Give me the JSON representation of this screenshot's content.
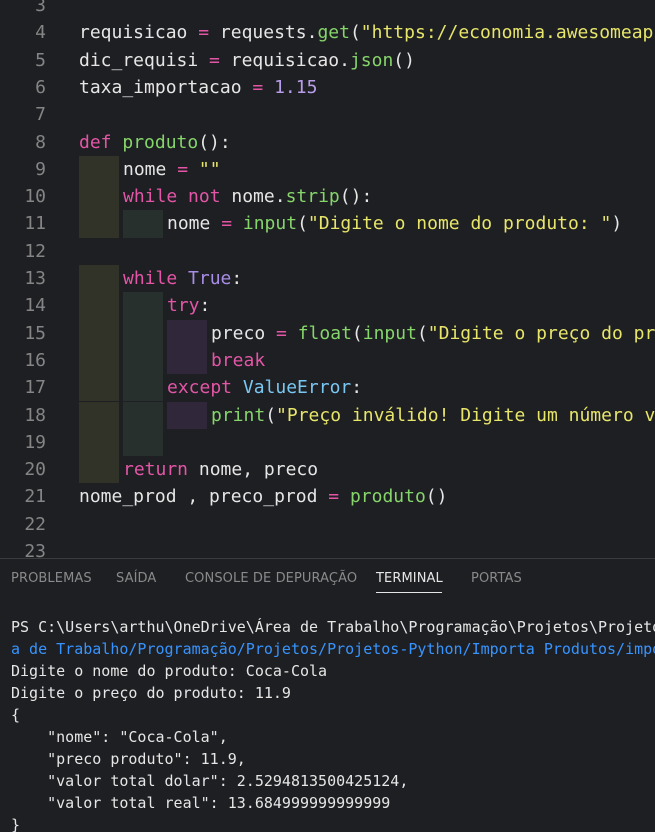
{
  "editor": {
    "lines": [
      {
        "num": "3",
        "tokens": []
      },
      {
        "num": "4",
        "tokens": [
          [
            "",
            "requisicao "
          ],
          [
            "op",
            "="
          ],
          [
            "",
            " requests."
          ],
          [
            "fn",
            "get"
          ],
          [
            "",
            "("
          ],
          [
            "str",
            "\"https://economia.awesomeapi"
          ]
        ]
      },
      {
        "num": "5",
        "tokens": [
          [
            "",
            "dic_requisi "
          ],
          [
            "op",
            "="
          ],
          [
            "",
            " requisicao."
          ],
          [
            "fn",
            "json"
          ],
          [
            "",
            "()"
          ]
        ]
      },
      {
        "num": "6",
        "tokens": [
          [
            "",
            "taxa_importacao "
          ],
          [
            "op",
            "="
          ],
          [
            "",
            ""
          ],
          [
            "num",
            " 1.15"
          ]
        ]
      },
      {
        "num": "7",
        "tokens": []
      },
      {
        "num": "8",
        "tokens": [
          [
            "kw",
            "def"
          ],
          [
            "",
            " "
          ],
          [
            "fn",
            "produto"
          ],
          [
            "",
            "():"
          ]
        ]
      },
      {
        "num": "9",
        "indent": 1,
        "tokens": [
          [
            "",
            "nome "
          ],
          [
            "op",
            "="
          ],
          [
            "",
            " "
          ],
          [
            "str",
            "\"\""
          ]
        ]
      },
      {
        "num": "10",
        "indent": 1,
        "tokens": [
          [
            "kw",
            "while"
          ],
          [
            "",
            " "
          ],
          [
            "kw",
            "not"
          ],
          [
            "",
            " nome."
          ],
          [
            "fn",
            "strip"
          ],
          [
            "",
            "():"
          ]
        ]
      },
      {
        "num": "11",
        "indent": 2,
        "tokens": [
          [
            "",
            "nome "
          ],
          [
            "op",
            "="
          ],
          [
            "",
            " "
          ],
          [
            "fn",
            "input"
          ],
          [
            "",
            "("
          ],
          [
            "str",
            "\"Digite o nome do produto: \""
          ],
          [
            "",
            ")"
          ]
        ]
      },
      {
        "num": "12",
        "tokens": []
      },
      {
        "num": "13",
        "indent": 1,
        "tokens": [
          [
            "kw",
            "while"
          ],
          [
            "",
            " "
          ],
          [
            "bt",
            "True"
          ],
          [
            "",
            ":"
          ]
        ]
      },
      {
        "num": "14",
        "indent": 2,
        "tokens": [
          [
            "kw",
            "try"
          ],
          [
            "",
            ":"
          ]
        ]
      },
      {
        "num": "15",
        "indent": 3,
        "tokens": [
          [
            "",
            "preco "
          ],
          [
            "op",
            "="
          ],
          [
            "",
            " "
          ],
          [
            "fn",
            "float"
          ],
          [
            "",
            "("
          ],
          [
            "fn",
            "input"
          ],
          [
            "",
            "("
          ],
          [
            "str",
            "\"Digite o preço do pr"
          ]
        ]
      },
      {
        "num": "16",
        "indent": 3,
        "tokens": [
          [
            "kw",
            "break"
          ]
        ]
      },
      {
        "num": "17",
        "indent": 2,
        "tokens": [
          [
            "kw",
            "except"
          ],
          [
            "",
            " "
          ],
          [
            "cls",
            "ValueError"
          ],
          [
            "",
            ":"
          ]
        ]
      },
      {
        "num": "18",
        "indent": 3,
        "tokens": [
          [
            "fn",
            "print"
          ],
          [
            "",
            "("
          ],
          [
            "str",
            "\"Preço inválido! Digite um número v"
          ]
        ]
      },
      {
        "num": "19",
        "guides": 2,
        "tokens": []
      },
      {
        "num": "20",
        "indent": 1,
        "tokens": [
          [
            "kw",
            "return"
          ],
          [
            "",
            " nome, preco"
          ]
        ]
      },
      {
        "num": "21",
        "tokens": [
          [
            "",
            "nome_prod , preco_prod "
          ],
          [
            "op",
            "="
          ],
          [
            "",
            " "
          ],
          [
            "fn",
            "produto"
          ],
          [
            "",
            "()"
          ]
        ]
      },
      {
        "num": "22",
        "tokens": []
      },
      {
        "num": "23",
        "tokens": []
      }
    ]
  },
  "panel": {
    "tabs": [
      {
        "label": "PROBLEMAS",
        "active": false
      },
      {
        "label": "SAÍDA",
        "active": false
      },
      {
        "label": "CONSOLE DE DEPURAÇÃO",
        "active": false
      },
      {
        "label": "TERMINAL",
        "active": true
      },
      {
        "label": "PORTAS",
        "active": false
      }
    ],
    "terminal": {
      "prompt_line": "PS C:\\Users\\arthu\\OneDrive\\Área de Trabalho\\Programação\\Projetos\\Projetos",
      "path_line": "a de Trabalho/Programação/Projetos/Projetos-Python/Importa Produtos/impo",
      "out1": "Digite o nome do produto: Coca-Cola",
      "out2": "Digite o preço do produto: 11.9",
      "out3": "{",
      "out4": "    \"nome\": \"Coca-Cola\",",
      "out5": "    \"preco produto\": 11.9,",
      "out6": "    \"valor total dolar\": 2.5294813500425124,",
      "out7": "    \"valor total real\": 13.684999999999999",
      "out8": "}"
    }
  }
}
